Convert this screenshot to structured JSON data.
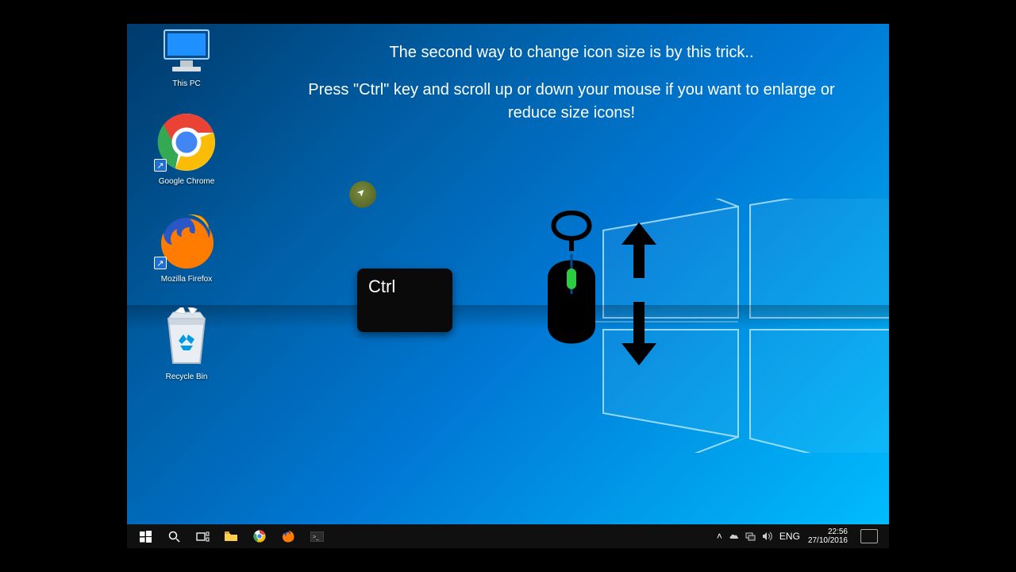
{
  "desktop": {
    "icons": [
      {
        "label": "This PC",
        "name": "this-pc-icon"
      },
      {
        "label": "Google Chrome",
        "name": "chrome-icon"
      },
      {
        "label": "Mozilla Firefox",
        "name": "firefox-icon"
      },
      {
        "label": "Recycle Bin",
        "name": "recycle-bin-icon"
      }
    ]
  },
  "overlay": {
    "line1": "The second way to change icon size is by this trick..",
    "line2": "Press \"Ctrl\" key and scroll up or down your mouse if you want to enlarge or reduce size icons!"
  },
  "key_label": "Ctrl",
  "taskbar": {
    "lang": "ENG",
    "time": "22:56",
    "date": "27/10/2016"
  }
}
